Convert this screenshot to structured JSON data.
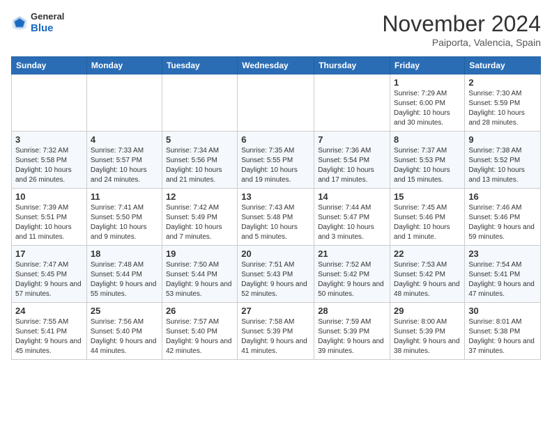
{
  "header": {
    "logo": {
      "general": "General",
      "blue": "Blue"
    },
    "title": "November 2024",
    "location": "Paiporta, Valencia, Spain"
  },
  "calendar": {
    "headers": [
      "Sunday",
      "Monday",
      "Tuesday",
      "Wednesday",
      "Thursday",
      "Friday",
      "Saturday"
    ],
    "weeks": [
      [
        {
          "day": null,
          "info": null
        },
        {
          "day": null,
          "info": null
        },
        {
          "day": null,
          "info": null
        },
        {
          "day": null,
          "info": null
        },
        {
          "day": null,
          "info": null
        },
        {
          "day": "1",
          "info": "Sunrise: 7:29 AM\nSunset: 6:00 PM\nDaylight: 10 hours and 30 minutes."
        },
        {
          "day": "2",
          "info": "Sunrise: 7:30 AM\nSunset: 5:59 PM\nDaylight: 10 hours and 28 minutes."
        }
      ],
      [
        {
          "day": "3",
          "info": "Sunrise: 7:32 AM\nSunset: 5:58 PM\nDaylight: 10 hours and 26 minutes."
        },
        {
          "day": "4",
          "info": "Sunrise: 7:33 AM\nSunset: 5:57 PM\nDaylight: 10 hours and 24 minutes."
        },
        {
          "day": "5",
          "info": "Sunrise: 7:34 AM\nSunset: 5:56 PM\nDaylight: 10 hours and 21 minutes."
        },
        {
          "day": "6",
          "info": "Sunrise: 7:35 AM\nSunset: 5:55 PM\nDaylight: 10 hours and 19 minutes."
        },
        {
          "day": "7",
          "info": "Sunrise: 7:36 AM\nSunset: 5:54 PM\nDaylight: 10 hours and 17 minutes."
        },
        {
          "day": "8",
          "info": "Sunrise: 7:37 AM\nSunset: 5:53 PM\nDaylight: 10 hours and 15 minutes."
        },
        {
          "day": "9",
          "info": "Sunrise: 7:38 AM\nSunset: 5:52 PM\nDaylight: 10 hours and 13 minutes."
        }
      ],
      [
        {
          "day": "10",
          "info": "Sunrise: 7:39 AM\nSunset: 5:51 PM\nDaylight: 10 hours and 11 minutes."
        },
        {
          "day": "11",
          "info": "Sunrise: 7:41 AM\nSunset: 5:50 PM\nDaylight: 10 hours and 9 minutes."
        },
        {
          "day": "12",
          "info": "Sunrise: 7:42 AM\nSunset: 5:49 PM\nDaylight: 10 hours and 7 minutes."
        },
        {
          "day": "13",
          "info": "Sunrise: 7:43 AM\nSunset: 5:48 PM\nDaylight: 10 hours and 5 minutes."
        },
        {
          "day": "14",
          "info": "Sunrise: 7:44 AM\nSunset: 5:47 PM\nDaylight: 10 hours and 3 minutes."
        },
        {
          "day": "15",
          "info": "Sunrise: 7:45 AM\nSunset: 5:46 PM\nDaylight: 10 hours and 1 minute."
        },
        {
          "day": "16",
          "info": "Sunrise: 7:46 AM\nSunset: 5:46 PM\nDaylight: 9 hours and 59 minutes."
        }
      ],
      [
        {
          "day": "17",
          "info": "Sunrise: 7:47 AM\nSunset: 5:45 PM\nDaylight: 9 hours and 57 minutes."
        },
        {
          "day": "18",
          "info": "Sunrise: 7:48 AM\nSunset: 5:44 PM\nDaylight: 9 hours and 55 minutes."
        },
        {
          "day": "19",
          "info": "Sunrise: 7:50 AM\nSunset: 5:44 PM\nDaylight: 9 hours and 53 minutes."
        },
        {
          "day": "20",
          "info": "Sunrise: 7:51 AM\nSunset: 5:43 PM\nDaylight: 9 hours and 52 minutes."
        },
        {
          "day": "21",
          "info": "Sunrise: 7:52 AM\nSunset: 5:42 PM\nDaylight: 9 hours and 50 minutes."
        },
        {
          "day": "22",
          "info": "Sunrise: 7:53 AM\nSunset: 5:42 PM\nDaylight: 9 hours and 48 minutes."
        },
        {
          "day": "23",
          "info": "Sunrise: 7:54 AM\nSunset: 5:41 PM\nDaylight: 9 hours and 47 minutes."
        }
      ],
      [
        {
          "day": "24",
          "info": "Sunrise: 7:55 AM\nSunset: 5:41 PM\nDaylight: 9 hours and 45 minutes."
        },
        {
          "day": "25",
          "info": "Sunrise: 7:56 AM\nSunset: 5:40 PM\nDaylight: 9 hours and 44 minutes."
        },
        {
          "day": "26",
          "info": "Sunrise: 7:57 AM\nSunset: 5:40 PM\nDaylight: 9 hours and 42 minutes."
        },
        {
          "day": "27",
          "info": "Sunrise: 7:58 AM\nSunset: 5:39 PM\nDaylight: 9 hours and 41 minutes."
        },
        {
          "day": "28",
          "info": "Sunrise: 7:59 AM\nSunset: 5:39 PM\nDaylight: 9 hours and 39 minutes."
        },
        {
          "day": "29",
          "info": "Sunrise: 8:00 AM\nSunset: 5:39 PM\nDaylight: 9 hours and 38 minutes."
        },
        {
          "day": "30",
          "info": "Sunrise: 8:01 AM\nSunset: 5:38 PM\nDaylight: 9 hours and 37 minutes."
        }
      ]
    ]
  }
}
